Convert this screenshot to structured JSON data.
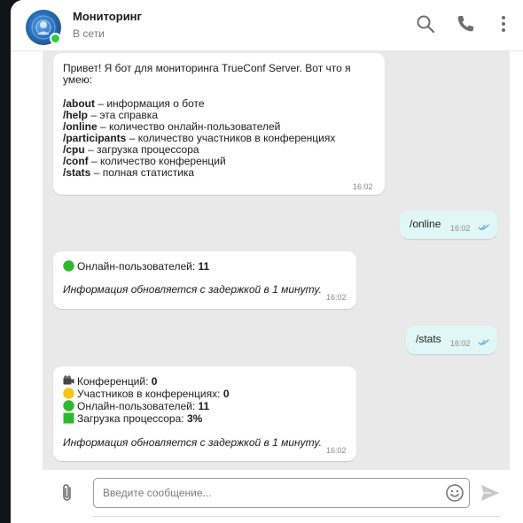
{
  "header": {
    "title": "Мониторинг",
    "status": "В сети",
    "icons": [
      "search-icon",
      "phone-icon",
      "more-vertical-icon"
    ],
    "online_color": "#2ecc40"
  },
  "messages": [
    {
      "type": "in",
      "lines": {
        "l1": "Привет! Я бот для мониторинга TrueConf Server. Вот что я",
        "l2": "умею:",
        "c1": "/about",
        "d1": " – информация о боте",
        "c2": "/help",
        "d2": " – эта справка",
        "c3": "/online",
        "d3": " – количество онлайн-пользователей",
        "c4": "/participants",
        "d4": " – количество участников в конференциях",
        "c5": "/cpu",
        "d5": " – загрузка процессора",
        "c6": "/conf",
        "d6": " – количество конференций",
        "c7": "/stats",
        "d7": " – полная статистика"
      },
      "time": "16:02"
    },
    {
      "type": "out",
      "text": "/online",
      "time": "16:02"
    },
    {
      "type": "in",
      "online_label": "Онлайн-пользователей: ",
      "online_value": "11",
      "note": "Информация обновляется с задержкой в 1 минуту.",
      "time": "16:02"
    },
    {
      "type": "out",
      "text": "/stats",
      "time": "16:02"
    },
    {
      "type": "in",
      "conf_label": "Конференций: ",
      "conf_value": "0",
      "part_label": "Участников в конференциях: ",
      "part_value": "0",
      "online_label": "Онлайн-пользователей: ",
      "online_value": "11",
      "cpu_label": "Загрузка процессора: ",
      "cpu_value": "3%",
      "note": "Информация обновляется с задержкой в 1 минуту.",
      "time": "16:02"
    }
  ],
  "input": {
    "placeholder": "Введите сообщение...",
    "icons": [
      "paperclip-icon",
      "smile-icon",
      "send-icon"
    ]
  },
  "colors": {
    "chat_bg": "#e9e9e9",
    "outgoing_bg": "#e1f7f7",
    "check": "#5b9bd5"
  }
}
